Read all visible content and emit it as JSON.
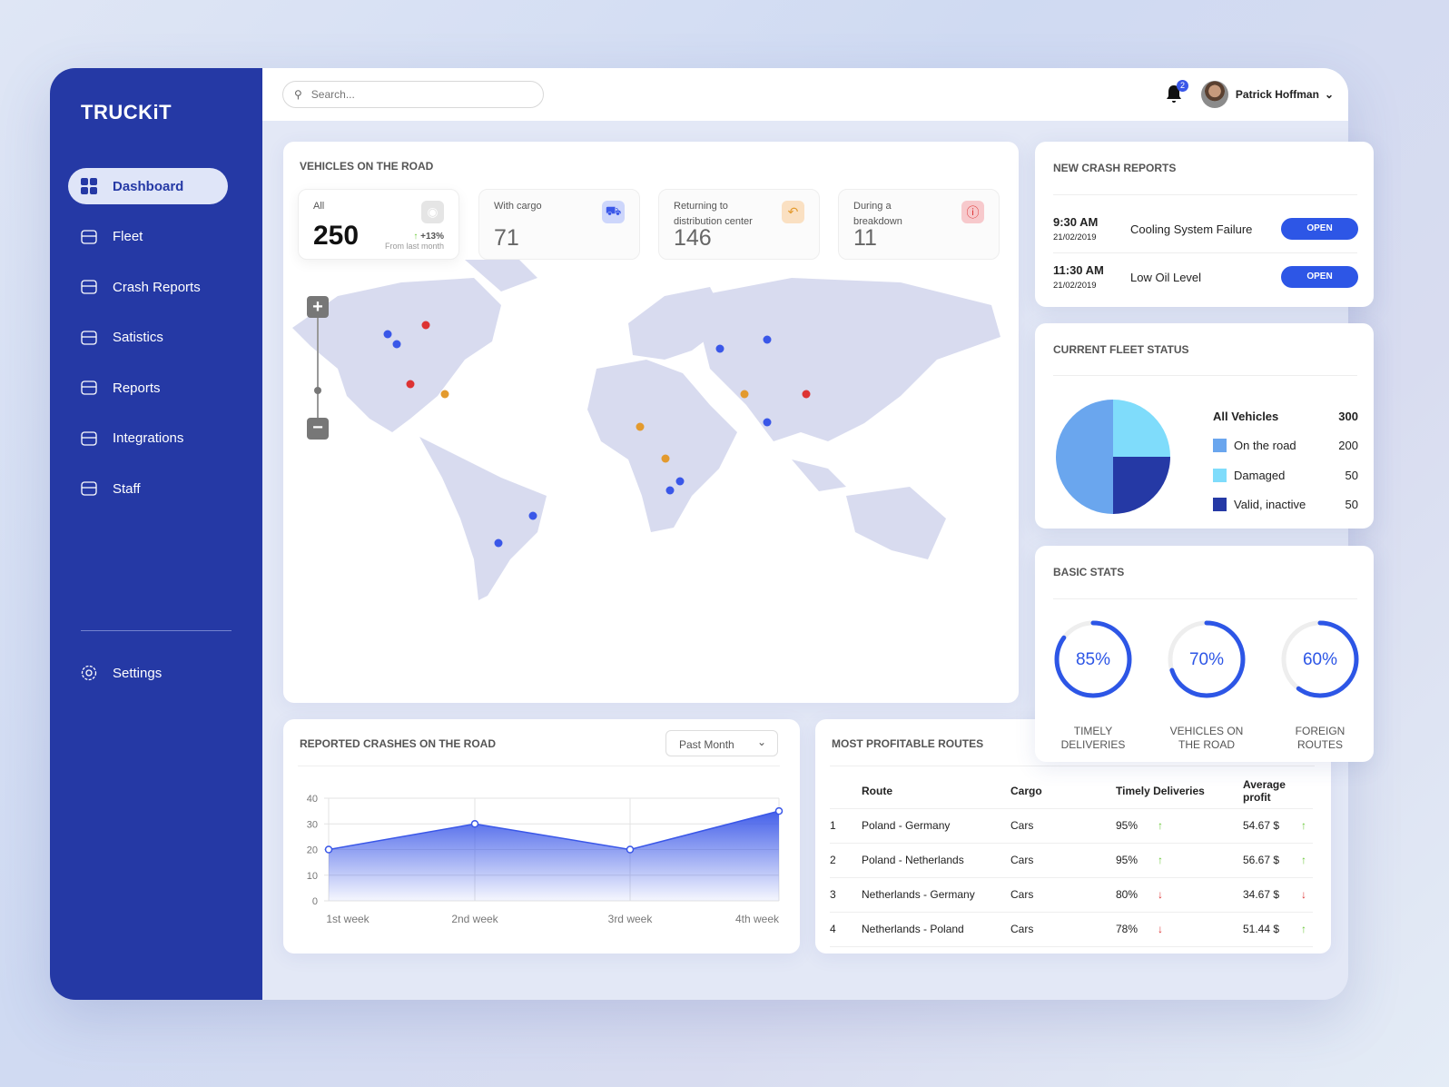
{
  "app": {
    "logo": "TRUCKiT"
  },
  "sidebar": {
    "items": [
      {
        "label": "Dashboard",
        "icon": "grid-icon"
      },
      {
        "label": "Fleet",
        "icon": "truck-icon"
      },
      {
        "label": "Crash Reports",
        "icon": "crash-icon"
      },
      {
        "label": "Satistics",
        "icon": "chart-line-icon"
      },
      {
        "label": "Reports",
        "icon": "pie-icon"
      },
      {
        "label": "Integrations",
        "icon": "integrations-icon"
      },
      {
        "label": "Staff",
        "icon": "staff-icon"
      }
    ],
    "settings": "Settings"
  },
  "topbar": {
    "search_placeholder": "Search...",
    "notifications": "2",
    "user": "Patrick Hoffman"
  },
  "vehicles": {
    "title": "VEHICLES ON THE ROAD",
    "stats": [
      {
        "label": "All",
        "value": "250",
        "change": "+13%",
        "change_sub": "From last month"
      },
      {
        "label": "With cargo",
        "value": "71",
        "color": "#3a57e8"
      },
      {
        "label": "Returning to distribution center",
        "value": "146",
        "color": "#e39a2e"
      },
      {
        "label": "During a breakdown",
        "value": "11",
        "color": "#d33"
      }
    ]
  },
  "crash_reports": {
    "title": "NEW CRASH REPORTS",
    "items": [
      {
        "time": "9:30 AM",
        "date": "21/02/2019",
        "desc": "Cooling System Failure",
        "action": "OPEN"
      },
      {
        "time": "11:30 AM",
        "date": "21/02/2019",
        "desc": "Low Oil Level",
        "action": "OPEN"
      }
    ]
  },
  "fleet": {
    "title": "CURRENT FLEET STATUS",
    "total_label": "All Vehicles",
    "total": "300",
    "items": [
      {
        "label": "On the road",
        "value": "200",
        "color": "#6aa6ee"
      },
      {
        "label": "Damaged",
        "value": "50",
        "color": "#7fdcfb"
      },
      {
        "label": "Valid, inactive",
        "value": "50",
        "color": "#2539a5"
      }
    ]
  },
  "basic_stats": {
    "title": "BASIC STATS",
    "items": [
      {
        "value": 85,
        "text": "85%",
        "label": "TIMELY DELIVERIES"
      },
      {
        "value": 70,
        "text": "70%",
        "label": "VEHICLES ON THE ROAD"
      },
      {
        "value": 60,
        "text": "60%",
        "label": "FOREIGN ROUTES"
      }
    ]
  },
  "crashes": {
    "title": "REPORTED CRASHES ON THE ROAD",
    "period": "Past Month"
  },
  "chart_data": {
    "type": "area",
    "title": "REPORTED CRASHES ON THE ROAD",
    "categories": [
      "1st week",
      "2nd week",
      "3rd week",
      "4th week"
    ],
    "values": [
      20,
      30,
      20,
      35
    ],
    "ylim": [
      0,
      40
    ],
    "yticks": [
      "0",
      "10",
      "20",
      "30",
      "40"
    ],
    "grid": true
  },
  "routes": {
    "title": "MOST PROFITABLE ROUTES",
    "headers": [
      "Route",
      "Cargo",
      "Timely Deliveries",
      "Average profit"
    ],
    "rows": [
      {
        "n": "1",
        "route": "Poland - Germany",
        "cargo": "Cars",
        "timely": "95%",
        "t_trend": "up",
        "profit": "54.67 $",
        "p_trend": "up"
      },
      {
        "n": "2",
        "route": "Poland - Netherlands",
        "cargo": "Cars",
        "timely": "95%",
        "t_trend": "up",
        "profit": "56.67 $",
        "p_trend": "up"
      },
      {
        "n": "3",
        "route": "Netherlands - Germany",
        "cargo": "Cars",
        "timely": "80%",
        "t_trend": "down",
        "profit": "34.67 $",
        "p_trend": "down"
      },
      {
        "n": "4",
        "route": "Netherlands - Poland",
        "cargo": "Cars",
        "timely": "78%",
        "t_trend": "down",
        "profit": "51.44 $",
        "p_trend": "up"
      }
    ]
  }
}
